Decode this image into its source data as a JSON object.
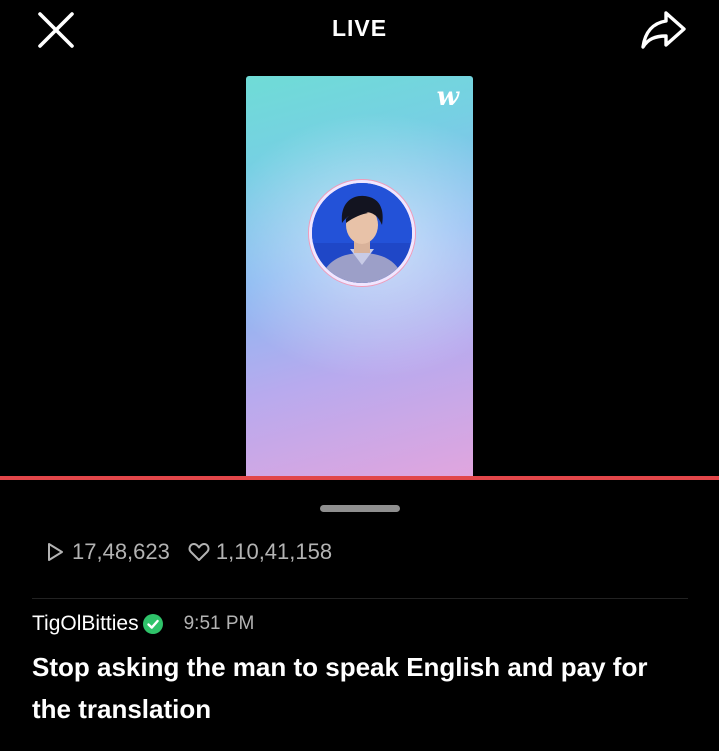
{
  "header": {
    "title": "LIVE"
  },
  "video": {
    "watermark": "w"
  },
  "stats": {
    "views": "17,48,623",
    "likes": "1,10,41,158"
  },
  "comment": {
    "username": "TigOlBitties",
    "time": "9:51 PM",
    "text": "Stop asking the man to speak English and pay for the translation"
  },
  "colors": {
    "progress": "#e24649",
    "verified": "#2fc36a"
  }
}
